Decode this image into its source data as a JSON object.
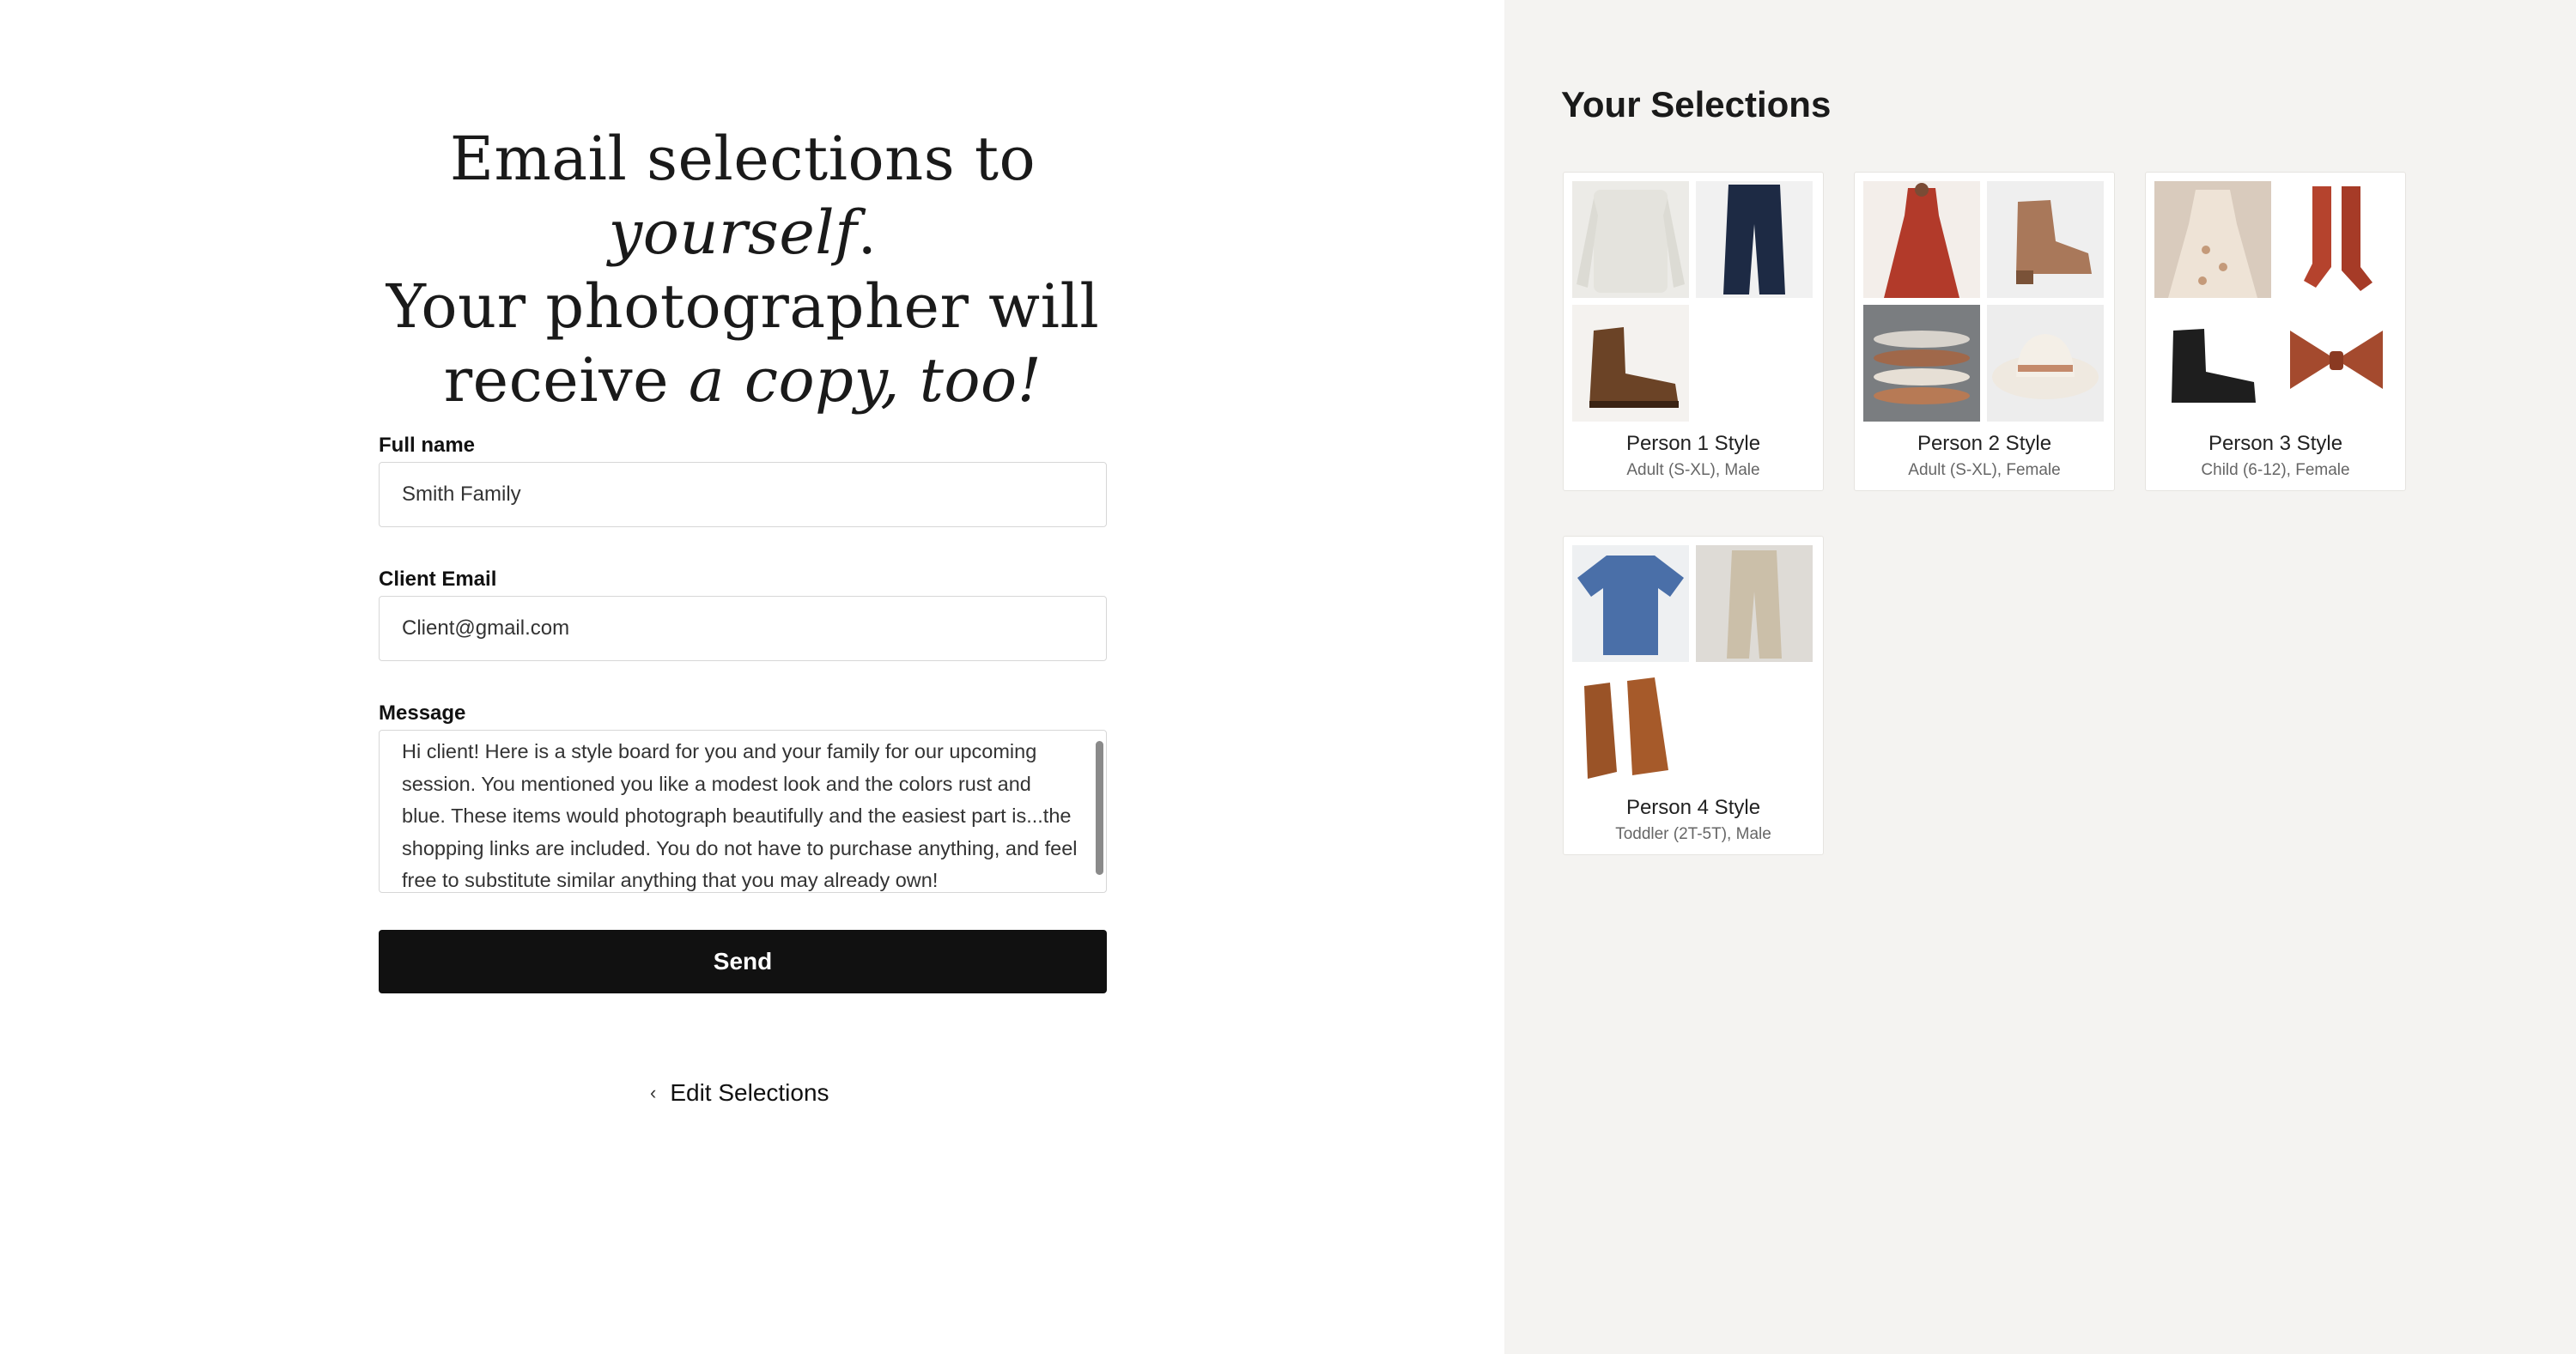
{
  "headline": {
    "line1_a": "Email selections to ",
    "line1_em": "yourself",
    "line1_b": ".",
    "line2": "Your photographer will",
    "line3_a": "receive ",
    "line3_em": "a copy, too!"
  },
  "form": {
    "name_label": "Full name",
    "name_value": "Smith Family",
    "email_label": "Client Email",
    "email_value": "Client@gmail.com",
    "message_label": "Message",
    "message_value": "Hi client! Here is a style board for you and your family for our upcoming session. You mentioned you like a modest look and the colors rust and blue. These items would photograph beautifully and the easiest part is...the shopping links are included. You do not have to purchase anything, and feel free to substitute similar anything that you may already own!",
    "send_label": "Send",
    "edit_label": "Edit Selections"
  },
  "selections": {
    "title": "Your Selections",
    "cards": [
      {
        "name": "Person 1 Style",
        "sub": "Adult (S-XL), Male"
      },
      {
        "name": "Person 2 Style",
        "sub": "Adult (S-XL), Female"
      },
      {
        "name": "Person 3 Style",
        "sub": "Child (6-12), Female"
      },
      {
        "name": "Person 4 Style",
        "sub": "Toddler (2T-5T), Male"
      }
    ]
  },
  "icons": {
    "edit": "chevron-left-icon"
  }
}
